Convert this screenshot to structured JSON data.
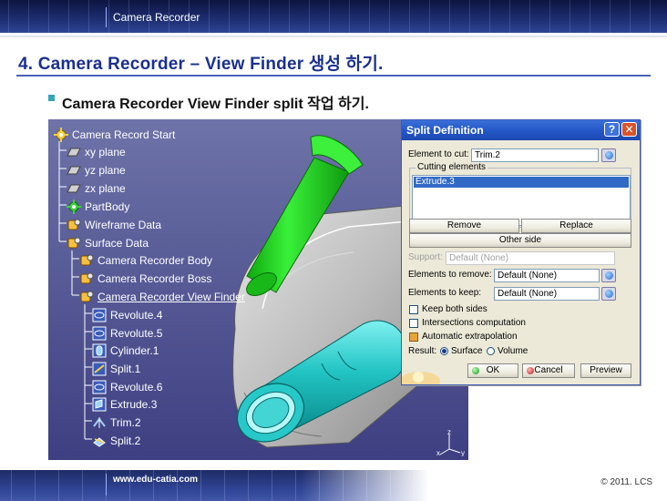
{
  "header": {
    "label": "Camera Recorder"
  },
  "title": "4. Camera Recorder – View Finder 생성 하기.",
  "bullet": "Camera Recorder View Finder split 작업 하기.",
  "footer": {
    "url": "www.edu-catia.com",
    "copyright": "© 2011. LCS"
  },
  "tree": {
    "items": [
      {
        "label": "Camera Record Start",
        "icon": "product-gear-icon"
      },
      {
        "label": "xy plane",
        "icon": "plane-icon"
      },
      {
        "label": "yz plane",
        "icon": "plane-icon"
      },
      {
        "label": "zx plane",
        "icon": "plane-icon"
      },
      {
        "label": "PartBody",
        "icon": "partbody-gear-icon"
      },
      {
        "label": "Wireframe Data",
        "icon": "geometrical-set-icon"
      },
      {
        "label": "Surface Data",
        "icon": "geometrical-set-icon"
      },
      {
        "label": "Camera Recorder Body",
        "icon": "geometrical-set-icon"
      },
      {
        "label": "Camera Recorder Boss",
        "icon": "geometrical-set-icon"
      },
      {
        "label": "Camera Recorder View Finder",
        "icon": "geometrical-set-icon"
      },
      {
        "label": "Revolute.4",
        "icon": "revolute-icon"
      },
      {
        "label": "Revolute.5",
        "icon": "revolute-icon"
      },
      {
        "label": "Cylinder.1",
        "icon": "cylinder-icon"
      },
      {
        "label": "Split.1",
        "icon": "split-icon"
      },
      {
        "label": "Revolute.6",
        "icon": "revolute-icon"
      },
      {
        "label": "Extrude.3",
        "icon": "extrude-icon"
      },
      {
        "label": "Trim.2",
        "icon": "trim-icon"
      },
      {
        "label": "Split.2",
        "icon": "split-icon"
      }
    ]
  },
  "axis": {
    "z": "z",
    "x": "x",
    "y": "y"
  },
  "dialog": {
    "title": "Split Definition",
    "element_to_cut_label": "Element to cut:",
    "element_to_cut_value": "Trim.2",
    "cutting_elements_label": "Cutting elements",
    "cutting_elements_selected": "Extrude.3",
    "remove_label": "Remove",
    "replace_label": "Replace",
    "other_side_label": "Other side",
    "support_label": "Support:",
    "support_value": "Default (None)",
    "elements_to_remove_label": "Elements to remove:",
    "elements_to_remove_value": "Default (None)",
    "elements_to_keep_label": "Elements to keep:",
    "elements_to_keep_value": "Default (None)",
    "keep_both_sides": {
      "label": "Keep both sides",
      "checked": false
    },
    "intersections_computation": {
      "label": "Intersections computation",
      "checked": false
    },
    "automatic_extrapolation": {
      "label": "Automatic extrapolation",
      "checked": true
    },
    "result_label": "Result:",
    "result_surface": "Surface",
    "result_volume": "Volume",
    "result_selected": "Surface",
    "ok_label": "OK",
    "cancel_label": "Cancel",
    "preview_label": "Preview"
  },
  "colors": {
    "title": "#1a2f8f",
    "viewport_bg": "#5a5e98",
    "green_part": "#22d122",
    "cyan_part": "#22c4c4",
    "dialog_bg": "#ece9d8",
    "titlebar": "#2458c8"
  }
}
